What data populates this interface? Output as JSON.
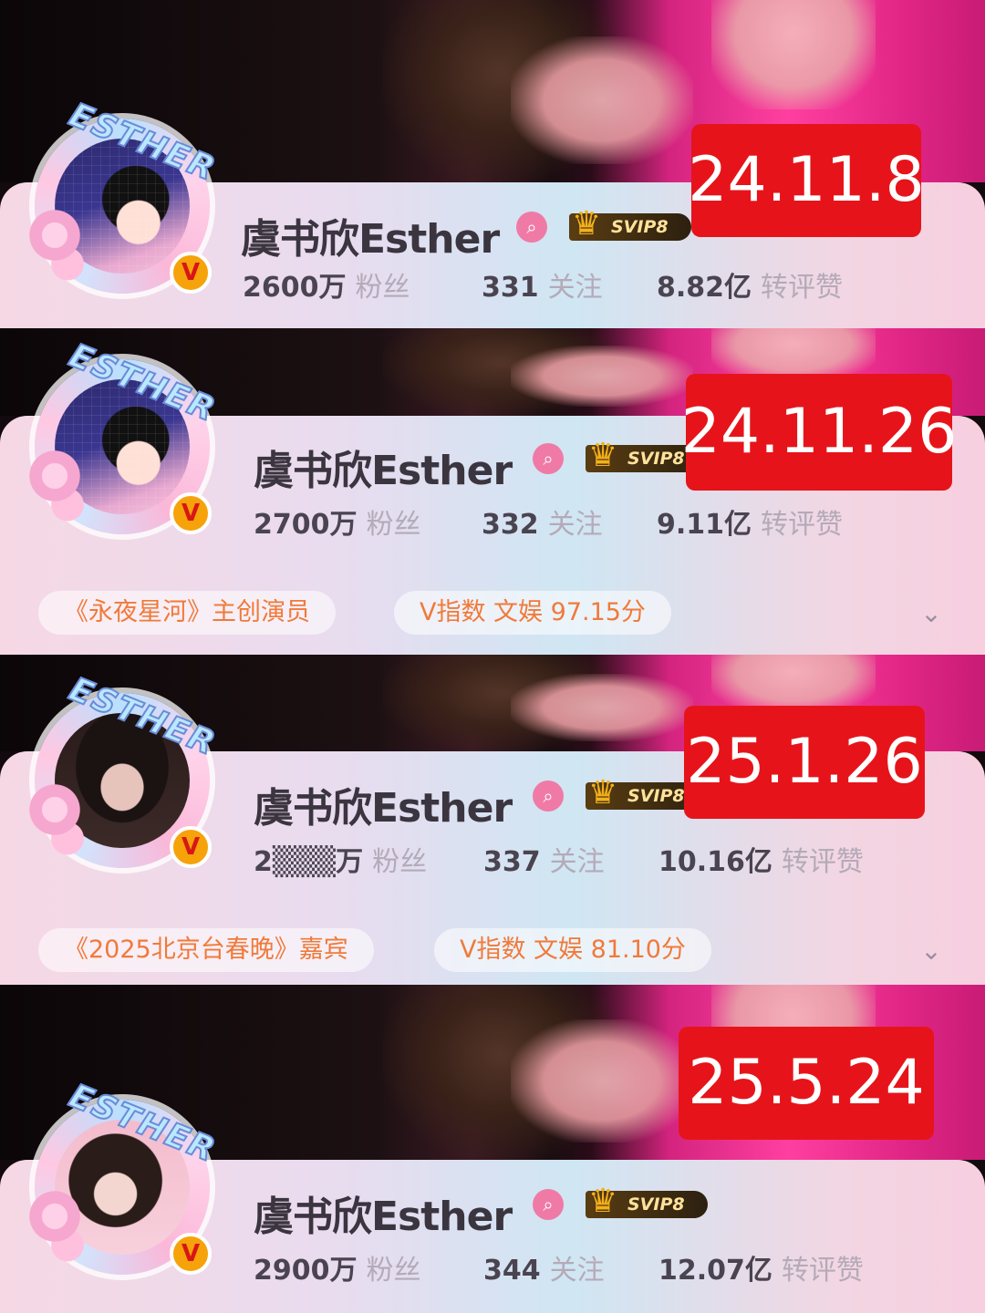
{
  "profiles": [
    {
      "date": "24.11.8",
      "name": "虞书欣Esther",
      "svip": "SVIP8",
      "verified": "V",
      "avatar_ring_text": "ESTHER",
      "followers": {
        "value": "2600万",
        "label": "粉丝"
      },
      "following": {
        "value": "331",
        "label": "关注"
      },
      "interactions": {
        "value": "8.82亿",
        "label": "转评赞"
      }
    },
    {
      "date": "24.11.26",
      "name": "虞书欣Esther",
      "svip": "SVIP8",
      "verified": "V",
      "avatar_ring_text": "ESTHER",
      "followers": {
        "value": "2700万",
        "label": "粉丝"
      },
      "following": {
        "value": "332",
        "label": "关注"
      },
      "interactions": {
        "value": "9.11亿",
        "label": "转评赞"
      },
      "tags": [
        "《永夜星河》主创演员",
        "V指数 文娱 97.15分"
      ]
    },
    {
      "date": "25.1.26",
      "name": "虞书欣Esther",
      "svip": "SVIP8",
      "verified": "V",
      "avatar_ring_text": "ESTHER",
      "followers": {
        "value": "2▒▒▒万",
        "label": "粉丝"
      },
      "following": {
        "value": "337",
        "label": "关注"
      },
      "interactions": {
        "value": "10.16亿",
        "label": "转评赞"
      },
      "tags": [
        "《2025北京台春晚》嘉宾",
        "V指数 文娱 81.10分"
      ]
    },
    {
      "date": "25.5.24",
      "name": "虞书欣Esther",
      "svip": "SVIP8",
      "verified": "V",
      "avatar_ring_text": "ESTHER",
      "followers": {
        "value": "2900万",
        "label": "粉丝"
      },
      "following": {
        "value": "344",
        "label": "关注"
      },
      "interactions": {
        "value": "12.07亿",
        "label": "转评赞"
      }
    }
  ],
  "icons": {
    "search": "search-icon",
    "crown": "crown-icon",
    "verified": "verified-v-icon",
    "expand": "chevron-down-icon"
  },
  "colors": {
    "date_badge": "#e6141a",
    "verified_badge": "#f6a20a",
    "tag_text": "#f07a3a"
  }
}
